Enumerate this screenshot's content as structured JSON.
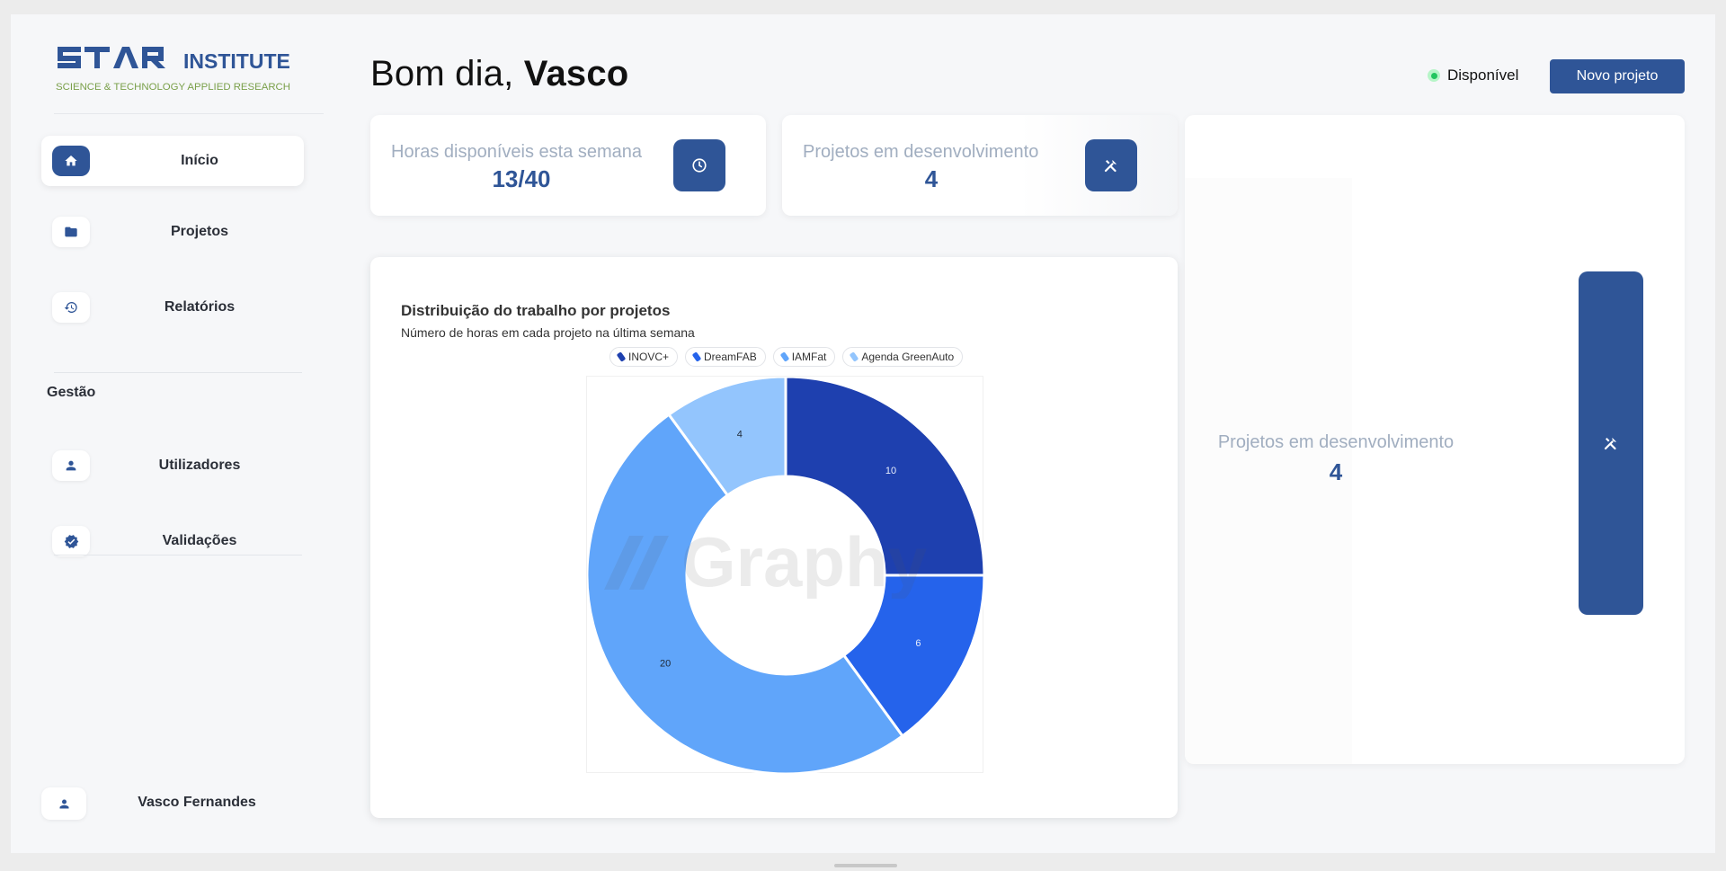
{
  "brand": {
    "name": "INSTITUTE",
    "tagline": "SCIENCE & TECHNOLOGY APPLIED RESEARCH",
    "color": "#2f5597",
    "tagline_color": "#7aa04a"
  },
  "sidebar": {
    "items": [
      {
        "label": "Início",
        "icon": "home-icon"
      },
      {
        "label": "Projetos",
        "icon": "folder-icon"
      },
      {
        "label": "Relatórios",
        "icon": "history-icon"
      }
    ],
    "section_title": "Gestão",
    "management_items": [
      {
        "label": "Utilizadores",
        "icon": "person-icon"
      },
      {
        "label": "Validações",
        "icon": "verified-badge-icon"
      }
    ],
    "user": {
      "name": "Vasco Fernandes",
      "icon": "person-icon"
    }
  },
  "header": {
    "greeting": "Bom dia,",
    "user_first_name": "Vasco",
    "status_label": "Disponível",
    "status_color": "#22c55e",
    "new_project_button": "Novo projeto"
  },
  "stats": [
    {
      "label": "Horas disponíveis esta semana",
      "value": "13/40",
      "icon": "clock-icon"
    },
    {
      "label": "Projetos em desenvolvimento",
      "value": "4",
      "icon": "tools-icon"
    }
  ],
  "side_card": {
    "label": "Projetos em desenvolvimento",
    "value": "4",
    "icon": "tools-icon"
  },
  "chart": {
    "title": "Distribuição do trabalho por projetos",
    "subtitle": "Número de horas em cada projeto na última semana",
    "watermark": "Graphy"
  },
  "chart_data": {
    "type": "pie",
    "donut": true,
    "title": "Distribuição do trabalho por projetos",
    "subtitle": "Número de horas em cada projeto na última semana",
    "legend_position": "top",
    "categories": [
      "INOVC+",
      "DreamFAB",
      "IAMFat",
      "Agenda GreenAuto"
    ],
    "values": [
      10,
      6,
      20,
      4
    ],
    "colors": [
      "#1e40af",
      "#2563eb",
      "#60a5fa",
      "#93c5fd"
    ]
  }
}
